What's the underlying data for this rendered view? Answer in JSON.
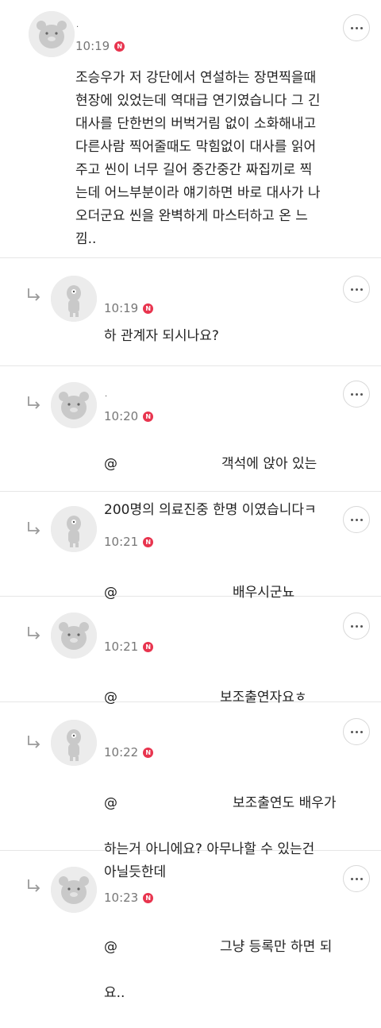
{
  "nbadge_label": "N",
  "comments": [
    {
      "author": ".",
      "time": "10:19",
      "text": "조승우가 저 강단에서 연설하는 장면찍을때\n현장에 있었는데 역대급 연기였습니다 그 긴\n대사를 단한번의 버벅거림 없이 소화해내고\n다른사람 찍어줄때도 막힘없이 대사를 읽어\n주고 씬이 너무 길어 중간중간 짜집끼로 찍\n는데 어느부분이라 얘기하면 바로 대사가 나\n오더군요 씬을 완벽하게 마스터하고 온 느\n낌.."
    },
    {
      "author": "",
      "time": "10:19",
      "text": "하 관계자 되시나요?"
    },
    {
      "author": ".",
      "time": "10:20",
      "at": "@",
      "text1": "객석에 앉아 있는",
      "text2": "200명의 의료진중 한명 이였습니다ㅋ"
    },
    {
      "author": "",
      "time": "10:21",
      "at": "@",
      "text1": "배우시군뇨"
    },
    {
      "author": "",
      "time": "10:21",
      "at": "@",
      "text1": "보조출연자요ㅎ"
    },
    {
      "author": "",
      "time": "10:22",
      "at": "@",
      "text1": "보조출연도 배우가",
      "text2": "하는거 아니에요? 아무나할 수 있는건\n아닐듯한데"
    },
    {
      "author": "",
      "time": "10:23",
      "at": "@",
      "text1": "그냥 등록만 하면 되",
      "text2": "요.."
    }
  ]
}
